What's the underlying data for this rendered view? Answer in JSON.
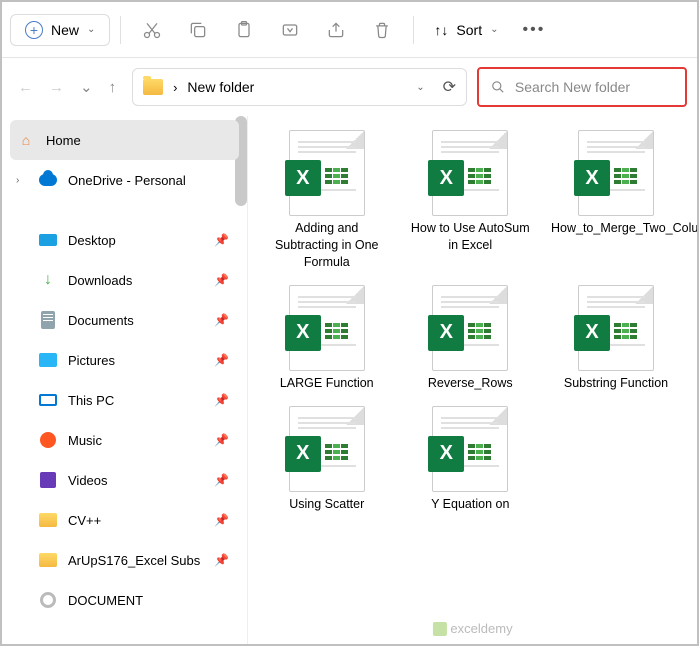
{
  "toolbar": {
    "new_label": "New",
    "sort_label": "Sort"
  },
  "address": {
    "path_prefix": "›",
    "path": "New folder"
  },
  "search": {
    "placeholder": "Search New folder"
  },
  "sidebar": {
    "home": "Home",
    "onedrive": "OneDrive - Personal",
    "items": [
      {
        "label": "Desktop",
        "icon": "desktop",
        "pinned": true
      },
      {
        "label": "Downloads",
        "icon": "downloads",
        "pinned": true
      },
      {
        "label": "Documents",
        "icon": "documents",
        "pinned": true
      },
      {
        "label": "Pictures",
        "icon": "pictures",
        "pinned": true
      },
      {
        "label": "This PC",
        "icon": "pc",
        "pinned": true
      },
      {
        "label": "Music",
        "icon": "music",
        "pinned": true
      },
      {
        "label": "Videos",
        "icon": "videos",
        "pinned": true
      },
      {
        "label": "CV++",
        "icon": "folder",
        "pinned": true
      },
      {
        "label": "ArUpS176_Excel Subs",
        "icon": "folder",
        "pinned": true
      },
      {
        "label": "DOCUMENT",
        "icon": "cd",
        "pinned": false
      }
    ]
  },
  "files": [
    {
      "name": "Adding and Subtracting in One Formula"
    },
    {
      "name": "How to Use AutoSum in Excel"
    },
    {
      "name": "How_to_Merge_Two_Columns"
    },
    {
      "name": "LARGE Function"
    },
    {
      "name": "Reverse_Rows"
    },
    {
      "name": "Substring Function"
    },
    {
      "name": "Using Scatter"
    },
    {
      "name": "Y Equation on"
    }
  ],
  "watermark": "exceldemy"
}
